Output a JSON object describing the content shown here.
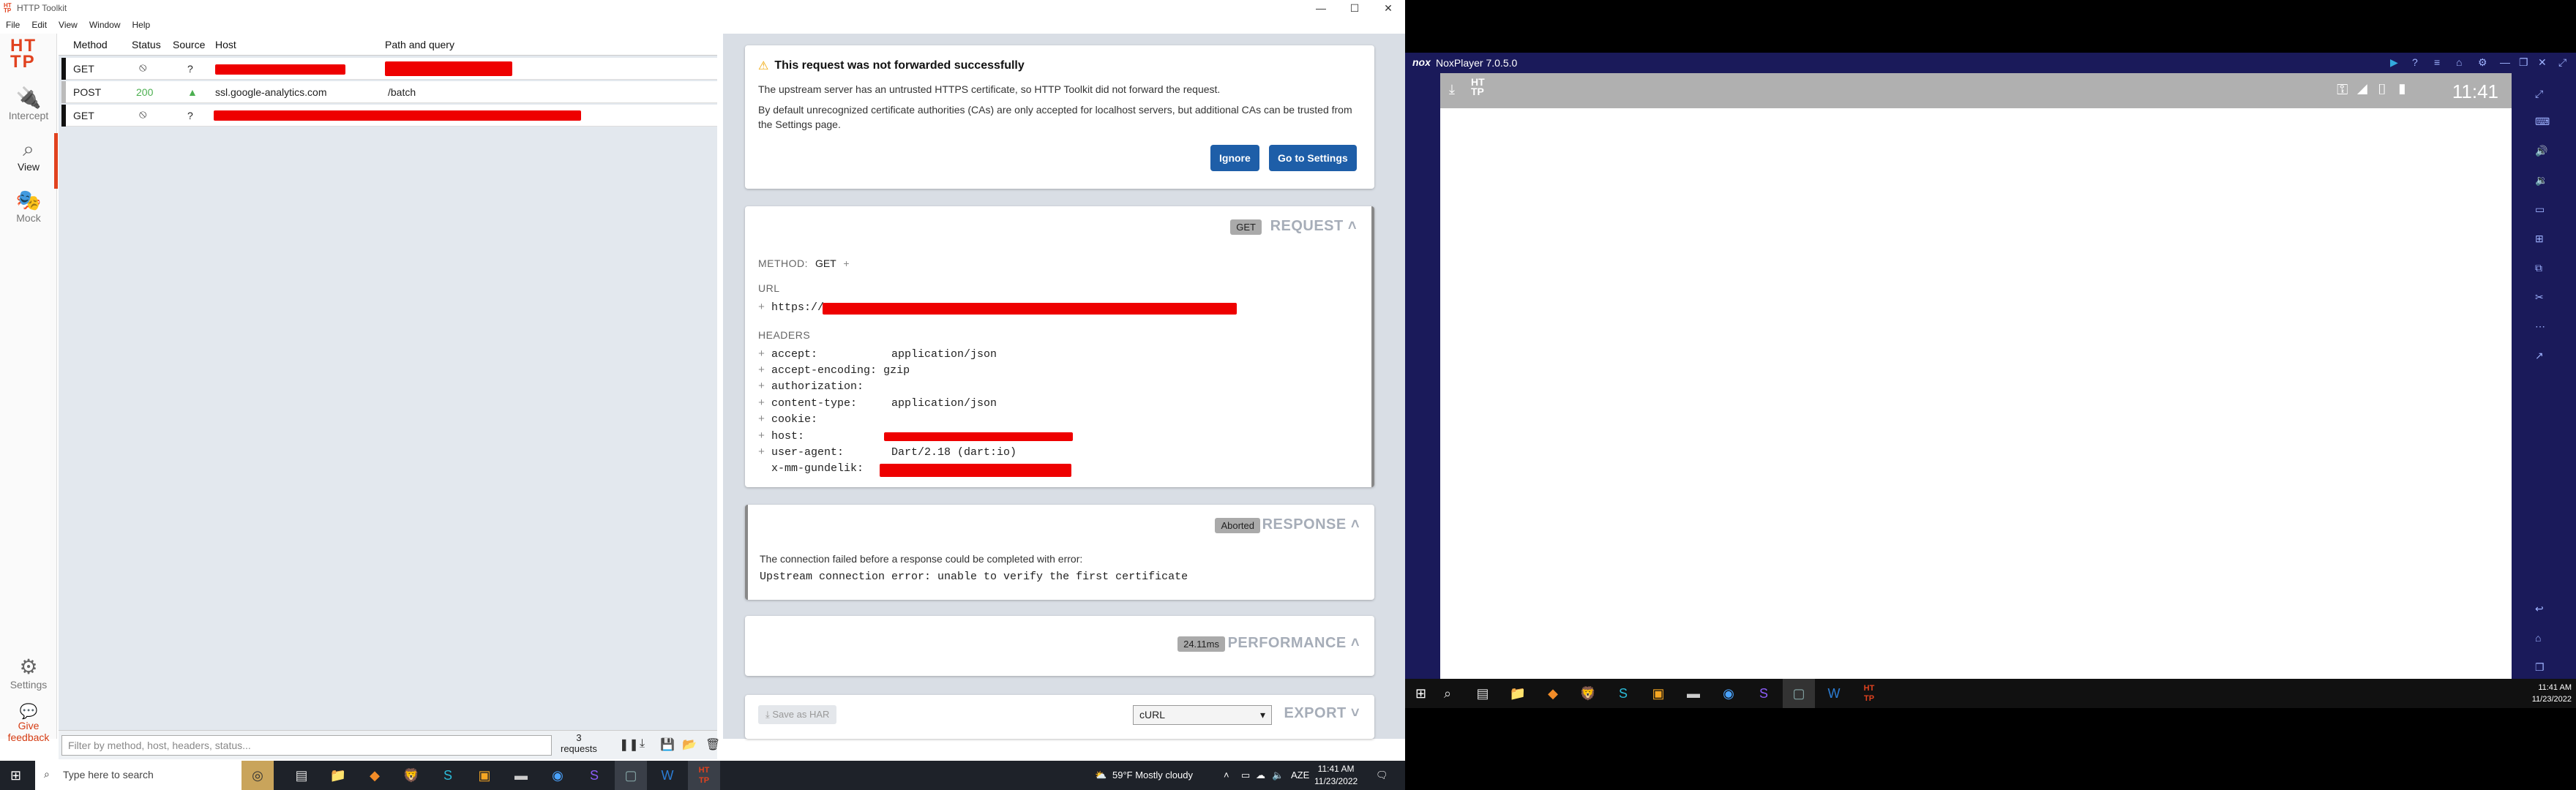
{
  "window": {
    "title": "HTTP Toolkit"
  },
  "menu": [
    "File",
    "Edit",
    "View",
    "Window",
    "Help"
  ],
  "window_controls": [
    "—",
    "☐",
    "✕"
  ],
  "sidebar": {
    "logo": "HT TP",
    "intercept": "Intercept",
    "view": "View",
    "mock": "Mock",
    "settings": "Settings",
    "feedback": "Give feedback"
  },
  "list": {
    "headers": {
      "method": "Method",
      "status": "Status",
      "source": "Source",
      "host": "Host",
      "path": "Path and query"
    },
    "rows": [
      {
        "method": "GET",
        "status": "⦸",
        "source": "?",
        "host": "",
        "path": ""
      },
      {
        "method": "POST",
        "status": "200",
        "source": "▲",
        "host": "ssl.google-analytics.com",
        "path": "/batch"
      },
      {
        "method": "GET",
        "status": "⦸",
        "source": "?",
        "host": "",
        "path": ""
      }
    ]
  },
  "filter": {
    "placeholder": "Filter by method, host, headers, status...",
    "count": "3",
    "count_label": "requests"
  },
  "alert": {
    "title": "This request was not forwarded successfully",
    "line1": "The upstream server has an untrusted HTTPS certificate, so HTTP Toolkit did not forward the request.",
    "line2": "By default unrecognized certificate authorities (CAs) are only accepted for localhost servers, but additional CAs can be trusted from the Settings page.",
    "ignore": "Ignore",
    "go_settings": "Go to Settings"
  },
  "request": {
    "badge": "GET",
    "title": "REQUEST",
    "method_label": "METHOD:",
    "method": "GET",
    "url_label": "URL",
    "url": "https://",
    "headers_label": "HEADERS",
    "headers": [
      {
        "k": "accept:",
        "v": "application/json"
      },
      {
        "k": "accept-encoding:",
        "v": "gzip"
      },
      {
        "k": "authorization:",
        "v": ""
      },
      {
        "k": "content-type:",
        "v": "application/json"
      },
      {
        "k": "cookie:",
        "v": ""
      },
      {
        "k": "host:",
        "v": ""
      },
      {
        "k": "user-agent:",
        "v": "Dart/2.18 (dart:io)"
      },
      {
        "k": "x-mm-gundelik:",
        "v": ""
      }
    ]
  },
  "response": {
    "badge": "Aborted",
    "title": "RESPONSE",
    "text": "The connection failed before a response could be completed with error:",
    "error": "Upstream connection error: unable to verify the first certificate"
  },
  "performance": {
    "badge": "24.11ms",
    "title": "PERFORMANCE"
  },
  "export": {
    "save": "Save as HAR",
    "format": "cURL",
    "title": "EXPORT"
  },
  "taskbar": {
    "search_placeholder": "Type here to search",
    "weather": "59°F  Mostly cloudy",
    "lang": "AZE",
    "time": "11:41 AM",
    "date": "11/23/2022"
  },
  "nox": {
    "brand": "nox",
    "title": "NoxPlayer 7.0.5.0",
    "status_time": "11:41",
    "app_logo": "HT TP"
  },
  "taskbar2": {
    "time": "11:41 AM",
    "date": "11/23/2022"
  },
  "colors": {
    "accent": "#e1421f",
    "primary_button": "#1e5ea8",
    "redaction": "#ee0000",
    "nox_frame": "#1a1a5a"
  }
}
